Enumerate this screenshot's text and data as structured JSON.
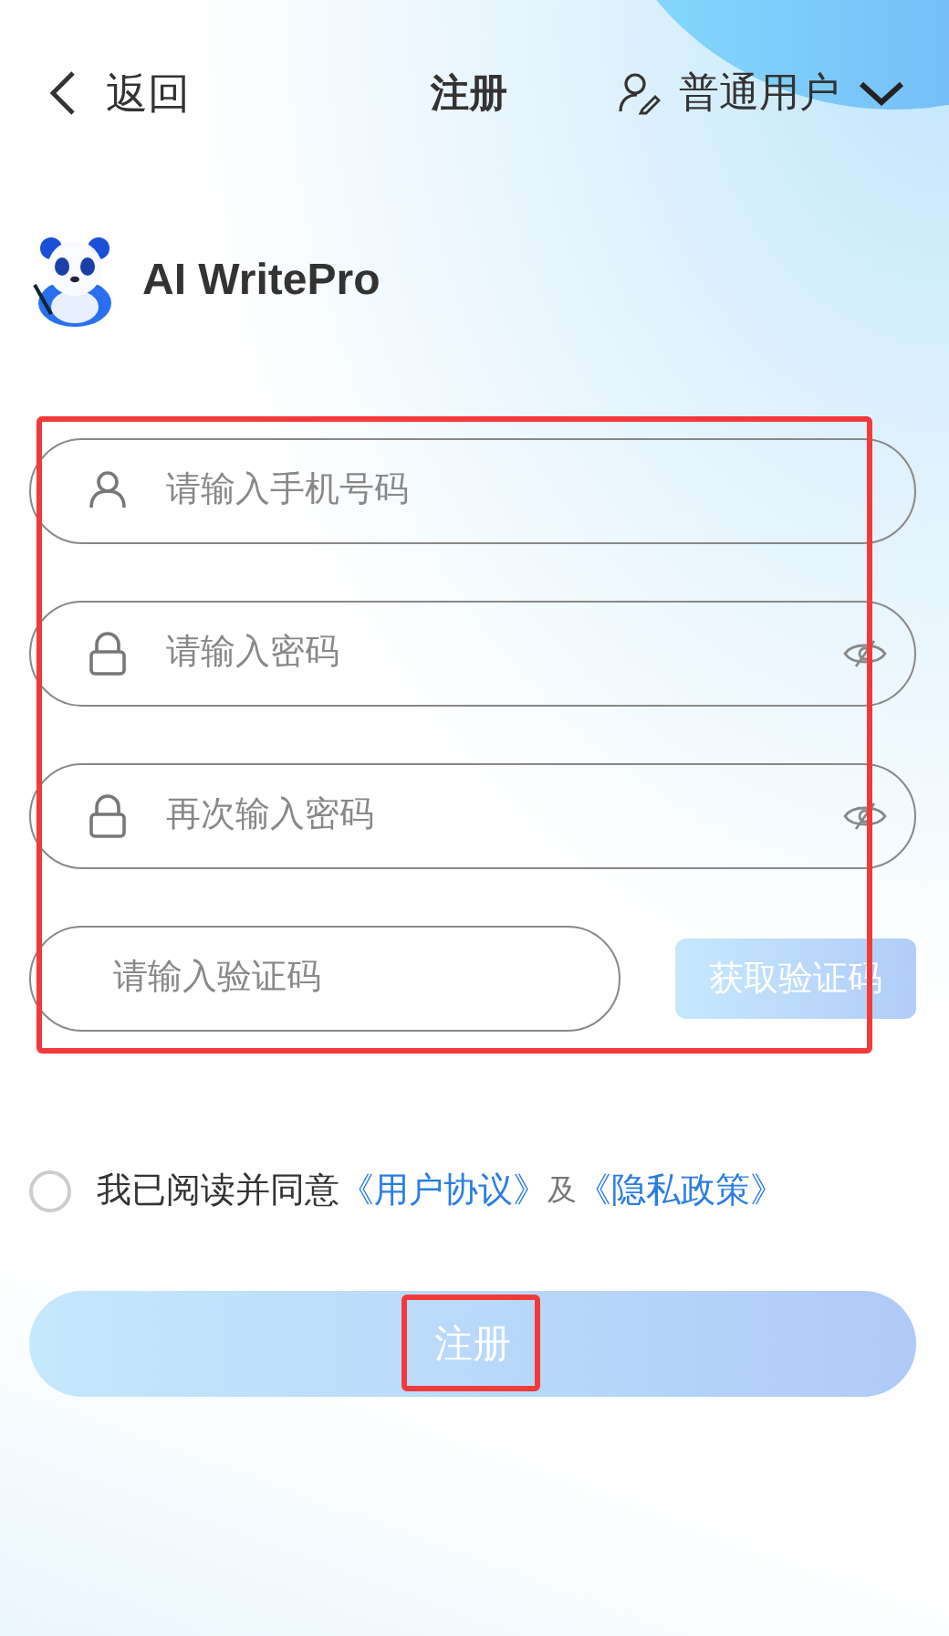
{
  "header": {
    "back_label": "返回",
    "title": "注册",
    "role": "普通用户"
  },
  "brand": {
    "name": "AI WritePro"
  },
  "fields": [
    {
      "kind": "account",
      "placeholder": "请输入手机号码"
    },
    {
      "kind": "password",
      "placeholder": "请输入密码"
    },
    {
      "kind": "password",
      "placeholder": "再次输入密码"
    },
    {
      "kind": "code",
      "placeholder": "请输入验证码",
      "button": {
        "label": "获取验证码",
        "disabled": true
      }
    }
  ],
  "agreement": {
    "checked": false,
    "text": "我已阅读并同意",
    "link_1": "《用户协议》",
    "joiner": "及",
    "link_2": "《隐私政策》"
  },
  "submit": {
    "label": "注册",
    "disabled": true
  }
}
